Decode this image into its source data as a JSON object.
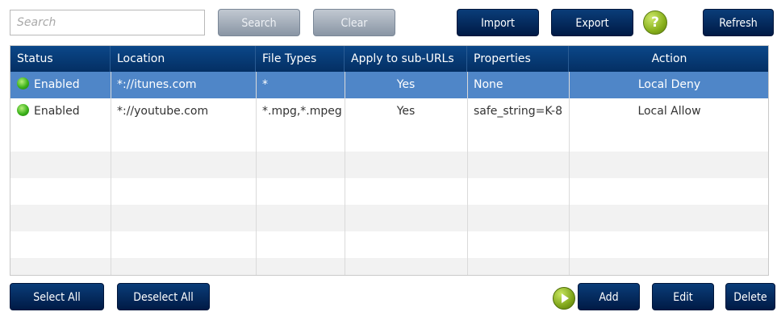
{
  "toolbar": {
    "search_placeholder": "Search",
    "search_label": "Search",
    "clear_label": "Clear",
    "import_label": "Import",
    "export_label": "Export",
    "help_label": "?",
    "refresh_label": "Refresh"
  },
  "table": {
    "columns": [
      "Status",
      "Location",
      "File Types",
      "Apply to sub-URLs",
      "Properties",
      "Action"
    ],
    "rows": [
      {
        "status": "Enabled",
        "location": "*://itunes.com",
        "file_types": "*",
        "apply_sub": "Yes",
        "properties": "None",
        "action": "Local Deny",
        "selected": true
      },
      {
        "status": "Enabled",
        "location": "*://youtube.com",
        "file_types": "*.mpg,*.mpeg",
        "apply_sub": "Yes",
        "properties": "safe_string=K-8",
        "action": "Local Allow",
        "selected": false
      }
    ]
  },
  "footer": {
    "select_all_label": "Select All",
    "deselect_all_label": "Deselect All",
    "add_label": "Add",
    "edit_label": "Edit",
    "delete_label": "Delete"
  },
  "colors": {
    "header_bg": "#0b4789",
    "selected_row": "#4f86c8",
    "status_enabled": "#3cb21b",
    "help_icon": "#88b01c"
  }
}
